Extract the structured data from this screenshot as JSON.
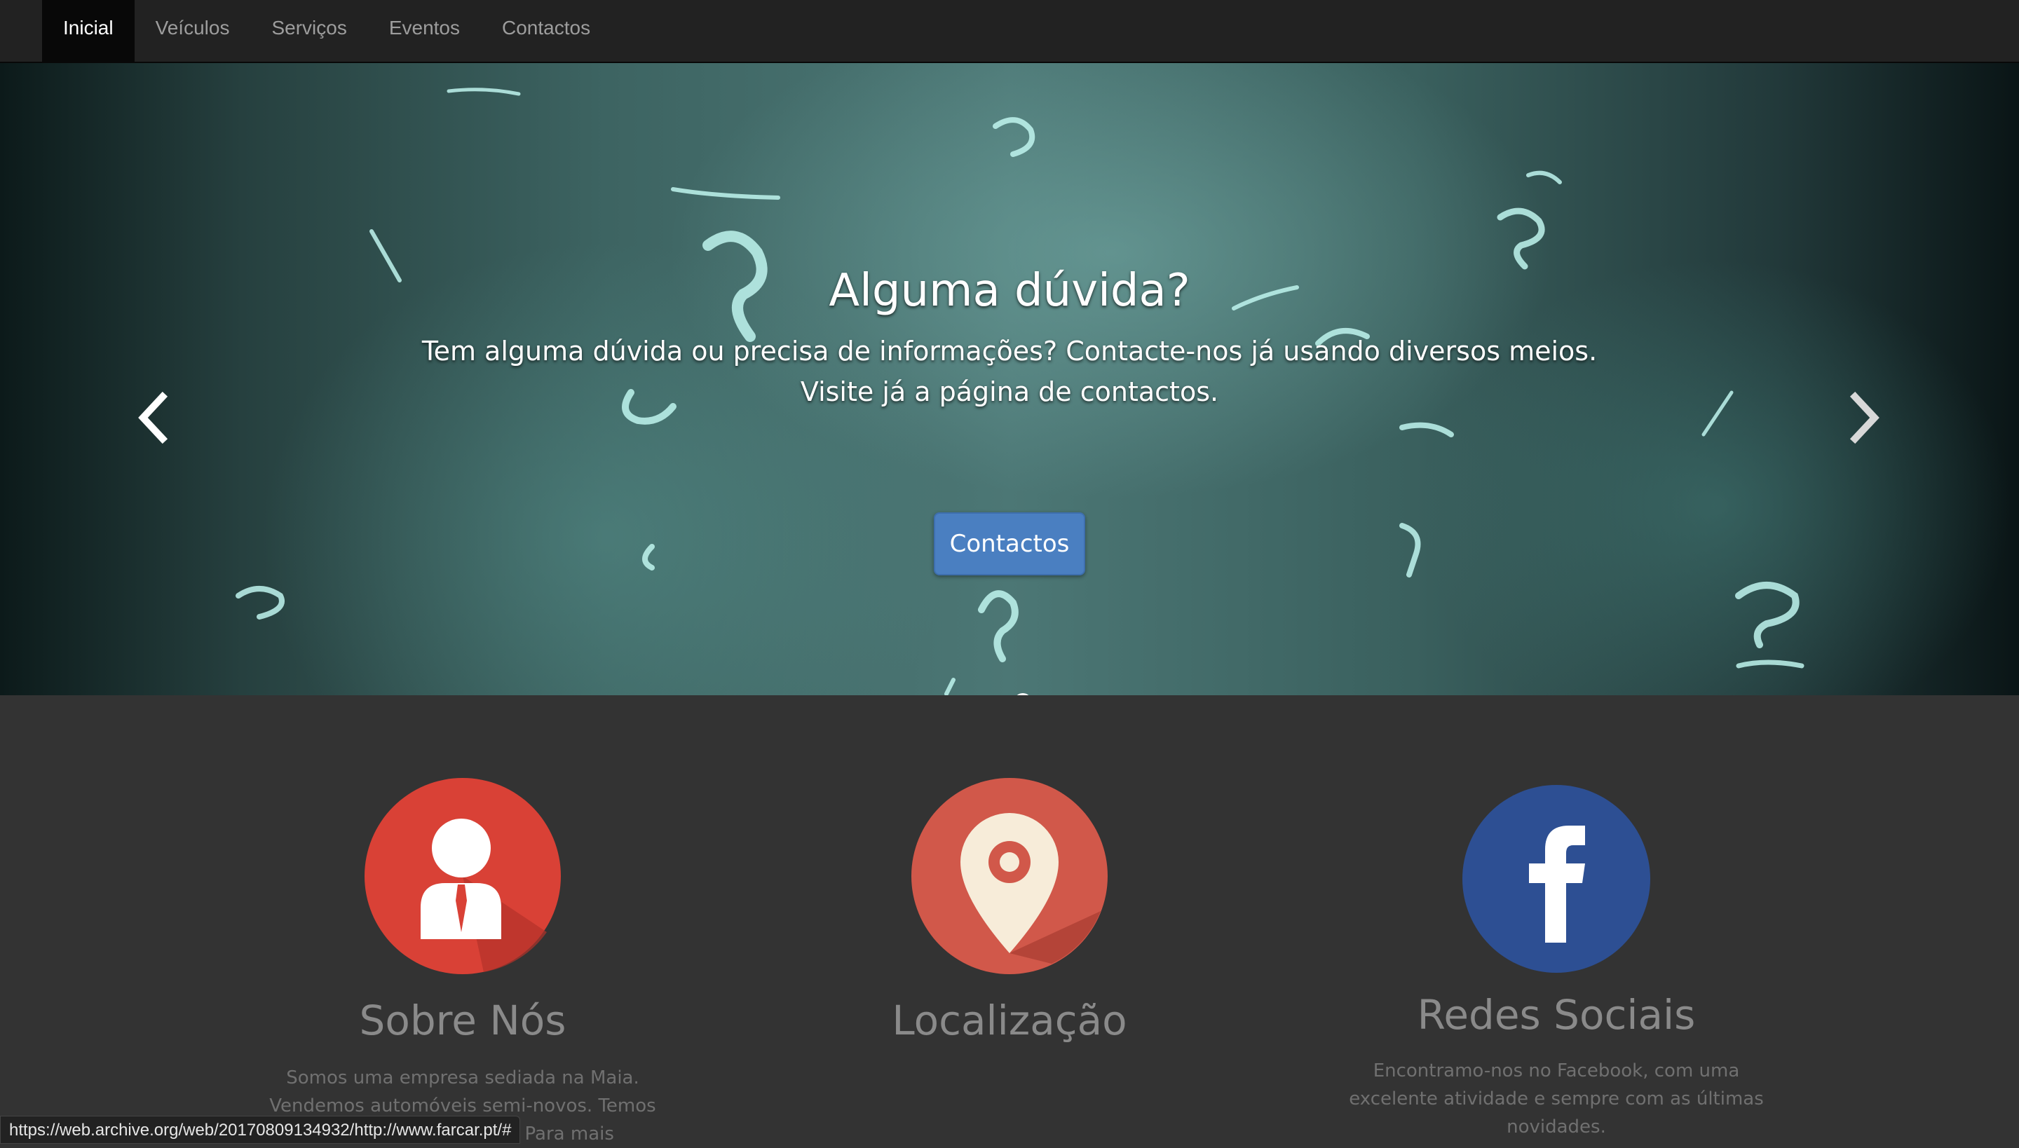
{
  "nav": {
    "items": [
      {
        "label": "Inicial",
        "active": true
      },
      {
        "label": "Veículos",
        "active": false
      },
      {
        "label": "Serviços",
        "active": false
      },
      {
        "label": "Eventos",
        "active": false
      },
      {
        "label": "Contactos",
        "active": false
      }
    ]
  },
  "carousel": {
    "title": "Alguma dúvida?",
    "text": "Tem alguma dúvida ou precisa de informações? Contacte-nos já usando diversos meios. Visite já a página de contactos.",
    "button_label": "Contactos",
    "slide_count": 3,
    "active_slide": 3,
    "prev_icon": "chevron-left-icon",
    "next_icon": "chevron-right-icon"
  },
  "features": [
    {
      "icon": "user-tie-icon",
      "title": "Sobre Nós",
      "text": "Somos uma empresa sediada na Maia. Vendemos automóveis semi-novos. Temos convenção com ... nto. Para mais",
      "color": "#d94136"
    },
    {
      "icon": "map-pin-icon",
      "title": "Localização",
      "text": "",
      "color": "#d1584a"
    },
    {
      "icon": "facebook-icon",
      "title": "Redes Sociais",
      "text": "Encontramo-nos no Facebook, com uma excelente atividade e sempre com as últimas novidades.",
      "color": "#2d4f93"
    }
  ],
  "status_bar": {
    "url": "https://web.archive.org/web/20170809134932/http://www.farcar.pt/#"
  },
  "colors": {
    "navbar": "#222222",
    "nav_active": "#080808",
    "page_background": "#333333",
    "button": "#4a7fc1"
  }
}
